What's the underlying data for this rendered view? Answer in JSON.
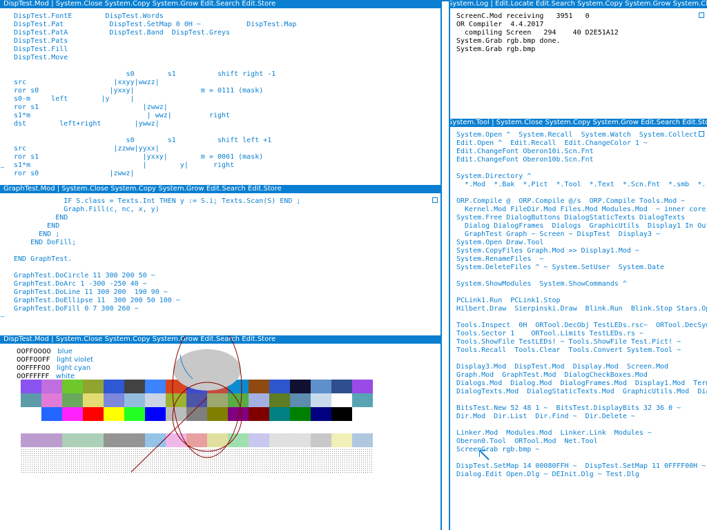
{
  "accent": "#0a7fd1",
  "dispTestTop": {
    "title": "DispTest.Mod | System.Close System.Copy System.Grow Edit.Search Edit.Store",
    "text": "DispTest.FontE        DispTest.Words\nDispTest.Pat           DispTest.SetMap 0 0H ~           DispTest.Map\nDispTest.PatA          DispTest.Band  DispTest.Greys\nDispTest.Pats\nDispTest.Fill\nDispTest.Move\n\n                           s0        s1          shift right -1\nsrc                     |xxyy|wwzz|\nror s0                 |yxxy|                m = 0111 (mask)\ns0-m     left        |y     |\nror s1                         |zwwz|\ns1*m                            | wwz|         right\ndst        left+right        |ywwz|\n\n                           s0        s1          shift left +1\nsrc                     |zzww|yyxx|\nror s1                         |yxxy|        m = 0001 (mask)\ns1*m                           |        y|      right\nror s0                 |zwwz|"
  },
  "graphTest": {
    "title": "GraphTest.Mod | System.Close System.Copy System.Grow Edit.Search Edit.Store",
    "text": "            IF S.class = Texts.Int THEN y := S.i; Texts.Scan(S) END ;\n            Graph.Fill(c, nc, x, y)\n          END\n        END\n      END ;\n    END DoFill;\n\nEND GraphTest.\n\nGraphTest.DoCircle 11 300 200 50 ~\nGraphTest.DoArc 1 -300 -250 40 ~\nGraphTest.DoLine 11 300 200  190 90 ~\nGraphTest.DoEllipse 11  300 200 50 100 ~\nGraphTest.DoFill 0 7 300 260 ~"
  },
  "dispTestBottom": {
    "title": "DispTest.Mod | System.Close System.Copy System.Grow Edit.Search Edit.Store",
    "colors": [
      {
        "hex": "00FF0000",
        "name": "blue"
      },
      {
        "hex": "00FF00FF",
        "name": "light violet"
      },
      {
        "hex": "00FFFF00",
        "name": "light cyan"
      },
      {
        "hex": "00FFFFFF",
        "name": "white"
      }
    ],
    "palette_row1": [
      "#8a52f0",
      "#c06ee0",
      "#6ec82a",
      "#90a430",
      "#2e58d4",
      "#424242",
      "#3c84ff",
      "#d8441e",
      "#3c4ccc",
      "#c44d3c",
      "#0c8bd0",
      "#8e4a10",
      "#2d55cc",
      "#101030",
      "#5e90cc",
      "#2f4e8e",
      "#9a4ae6"
    ],
    "palette_row2": [
      "#5c9ca8",
      "#e07cd8",
      "#6aa860",
      "#e4dc70",
      "#7c88dc",
      "#94bcdc",
      "#cad4e4",
      "#9cb230",
      "#4c54a8",
      "#9ca870",
      "#58ac44",
      "#a4b0e0",
      "#5e7c24",
      "#5c8cae",
      "#c8dcec",
      "#ffffff",
      "#58a4b4"
    ],
    "palette_row3": [
      "#2266ff",
      "#ff22ff",
      "#ff0000",
      "#ffff00",
      "#22ff22",
      "#0000ff",
      "#bcbcbc",
      "#7f7f7f",
      "#808000",
      "#800080",
      "#800000",
      "#008080",
      "#008000",
      "#000080",
      "#000000"
    ],
    "pattern_row": [
      "#7a3aa0",
      "#7a3aa0",
      "#5aa070",
      "#5aa070",
      "#2a2a2a",
      "#2a2a2a",
      "#2a88d0",
      "#e070d0",
      "#d04040",
      "#c0c040",
      "#40c060",
      "#9090e0",
      "#c0c0c0",
      "#c0c0c0",
      "#909090",
      "#e0e070",
      "#6090c0"
    ]
  },
  "systemLog": {
    "title": "System.Log | Edit.Locate Edit.Search System.Copy System.Grow System.Clear",
    "text": "ScreenC.Mod receiving   3951   0\nOR Compiler  4.4.2017\n  compiling Screen   294    40 D2E51A12\nSystem.Grab rgb.bmp done.\nSystem.Grab rgb.bmp"
  },
  "systemTool": {
    "title": "System.Tool | System.Close System.Copy System.Grow Edit.Search Edit.Store",
    "text": "System.Open ^  System.Recall  System.Watch  System.Collect\nEdit.Open ^  Edit.Recall  Edit.ChangeColor 1 ~\nEdit.ChangeFont Oberon10i.Scn.Fnt\nEdit.ChangeFont Oberon10b.Scn.Fnt\n\nSystem.Directory ^\n  *.Mod  *.Bak  *.Pict  *.Tool  *.Text  *.Scn.Fnt  *.smb  *.rsc!  *.bin!  *.txt\n\nORP.Compile @  ORP.Compile @/s  ORP.Compile Tools.Mod ~\n  Kernel.Mod FileDir.Mod Files.Mod Modules.Mod  ~ inner core\nSystem.Free DialogButtons DialogStaticTexts DialogTexts\n  Dialog DialogFrames  Dialogs  GraphicUtils  Display1 In Out  ~\n  GraphTest Graph ~ Screen ~ DispTest  Display3 ~\nSystem.Open Draw.Tool\nSystem.CopyFiles Graph.Mod => Display1.Mod ~\nSystem.RenameFiles  ~\nSystem.DeleteFiles ^ ~ System.SetUser  System.Date\n\nSystem.ShowModules  System.ShowCommands ^\n\nPCLink1.Run  PCLink1.Stop\nHilbert.Draw  Sierpinski.Draw  Blink.Run  Blink.Stop Stars.Open\n\nTools.Inspect  0H  ORTool.DecObj TestLEDs.rsc~  ORTool.DecSym  ~\nTools.Sector 1    ORTool.Limits TestLEDs.rs ~\nTools.ShowFile TestLEDs! ~ Tools.ShowFile Test.Pict! ~\nTools.Recall  Tools.Clear  Tools.Convert System.Tool ~\n\nDisplay3.Mod  DispTest.Mod  Display.Mod  Screen.Mod\nGraph.Mod  GraphTest.Mod  DialogCheckBoxes.Mod\nDialogs.Mod  Dialog.Mod  DialogFrames.Mod  Display1.Mod  Term.Mod\nDialogTexts.Mod  DialogStaticTexts.Mod  GraphicUtils.Mod  DialogButtons.\n\nBitsTest.New 52 48 1 ~  BitsTest.DisplayBits 32 36 0 ~\nDir.Mod  Dir.List  Dir.Find ~  Dir.Delete ~\n\nLinker.Mod  Modules.Mod  Linker.Link  Modules ~\nOberon0.Tool  ORTool.Mod  Net.Tool\nScreenGrab rgb.bmp ~\n\nDispTest.SetMap 14 00080FFH ~  DispTest.SetMap 11 0FFFF00H ~\nDialog.Edit Open.Dlg ~ DEInit.Dlg ~ Test.Dlg"
  }
}
